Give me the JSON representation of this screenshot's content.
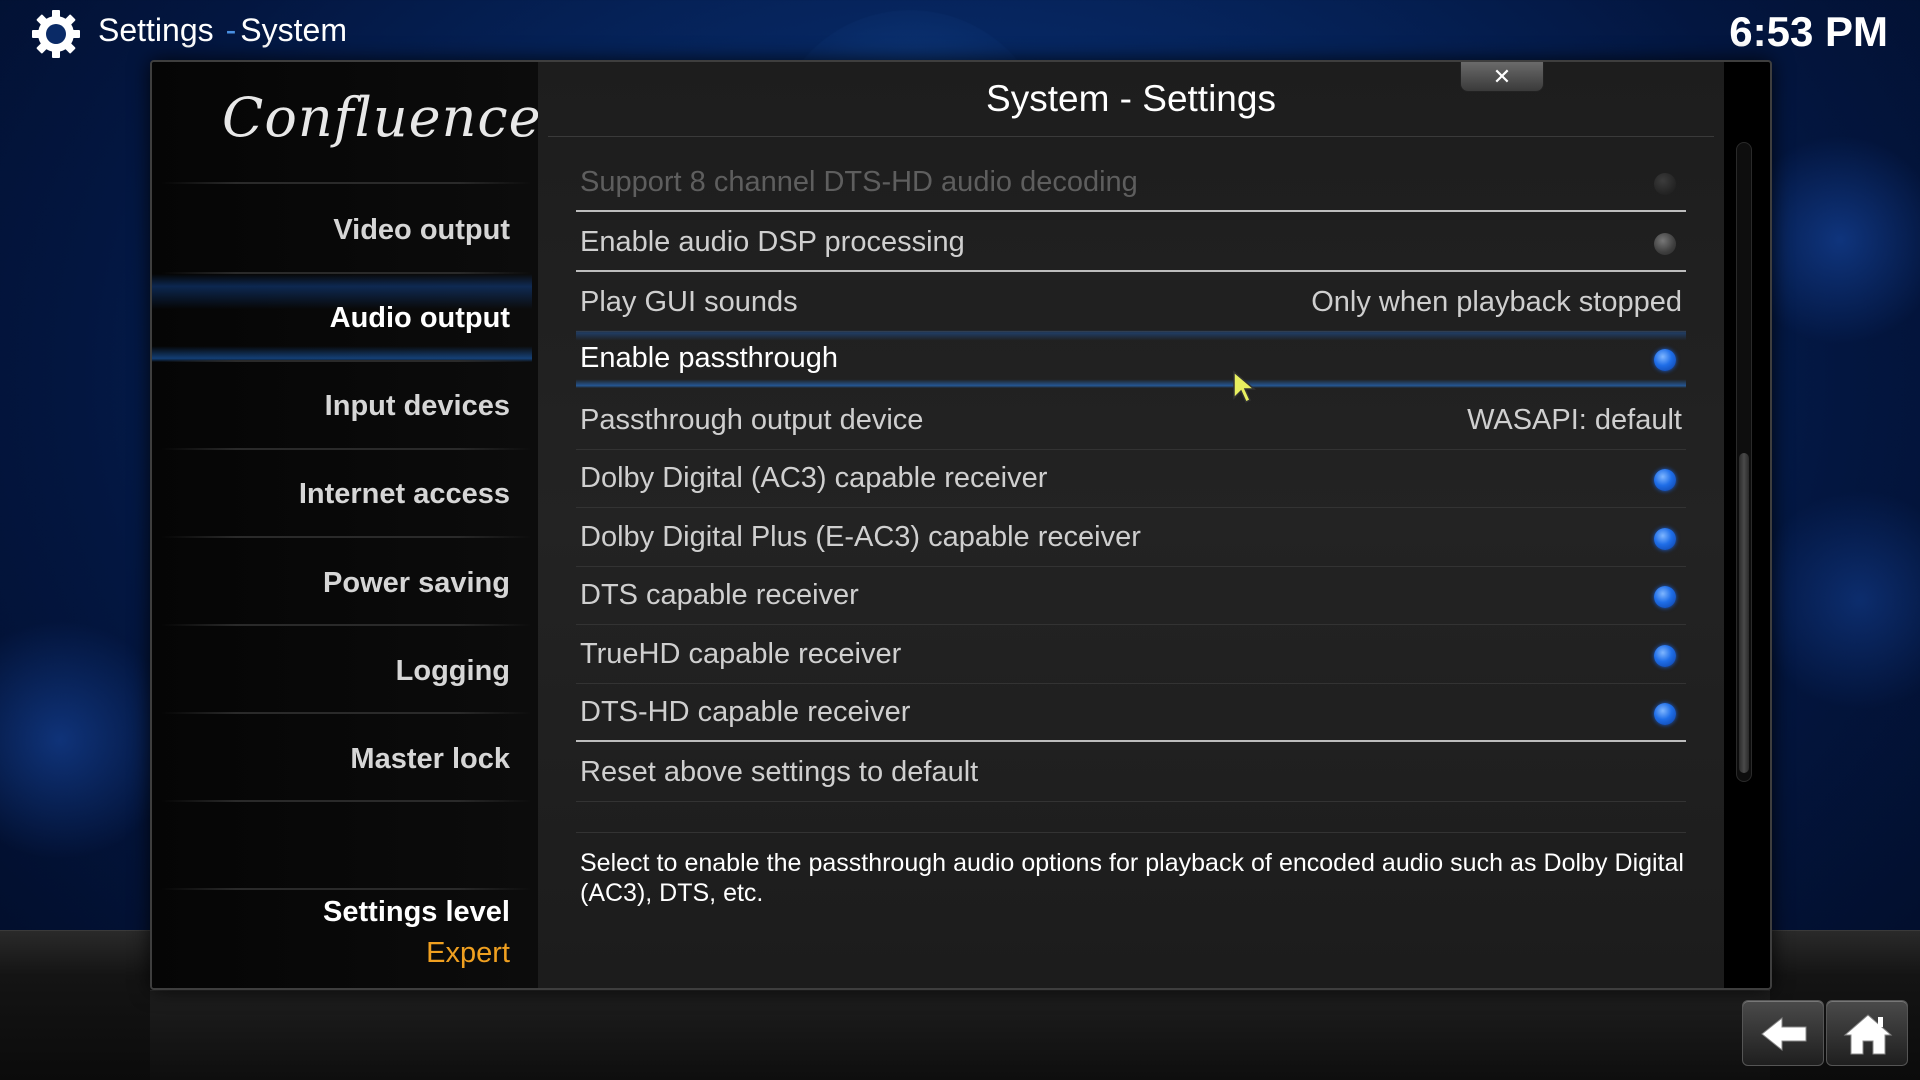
{
  "header": {
    "app_section": "Settings",
    "separator": "-",
    "sub_section": "System",
    "clock": "6:53 PM"
  },
  "sidebar": {
    "logo_text": "Confluence",
    "items": [
      {
        "label": "Video output"
      },
      {
        "label": "Audio output"
      },
      {
        "label": "Input devices"
      },
      {
        "label": "Internet access"
      },
      {
        "label": "Power saving"
      },
      {
        "label": "Logging"
      },
      {
        "label": "Master lock"
      }
    ],
    "active_item": "Audio output",
    "settings_level_label": "Settings level",
    "settings_level_value": "Expert"
  },
  "dialog": {
    "title": "System - Settings",
    "close_label": "✕"
  },
  "settings": [
    {
      "label": "Support 8 channel DTS-HD audio decoding",
      "type": "toggle",
      "state": "disabled"
    },
    {
      "label": "Enable audio DSP processing",
      "type": "toggle",
      "state": "off"
    },
    {
      "label": "Play GUI sounds",
      "type": "value",
      "value": "Only when playback stopped"
    },
    {
      "label": "Enable passthrough",
      "type": "toggle",
      "state": "on",
      "selected": true
    },
    {
      "label": "Passthrough output device",
      "type": "value",
      "value": "WASAPI: default"
    },
    {
      "label": "Dolby Digital (AC3) capable receiver",
      "type": "toggle",
      "state": "on"
    },
    {
      "label": "Dolby Digital Plus (E-AC3) capable receiver",
      "type": "toggle",
      "state": "on"
    },
    {
      "label": "DTS capable receiver",
      "type": "toggle",
      "state": "on"
    },
    {
      "label": "TrueHD capable receiver",
      "type": "toggle",
      "state": "on"
    },
    {
      "label": "DTS-HD capable receiver",
      "type": "toggle",
      "state": "on"
    },
    {
      "label": "Reset above settings to default",
      "type": "action"
    }
  ],
  "description": "Select to enable the passthrough audio options for playback of encoded audio such as Dolby Digital (AC3), DTS, etc.",
  "icons": {
    "settings": "gear-icon",
    "close": "close-icon",
    "back": "back-arrow-icon",
    "home": "home-icon"
  },
  "colors": {
    "accent": "#1f6ee8",
    "settings_level_value": "#f0a020",
    "breadcrumb_separator": "#4a90e2"
  }
}
